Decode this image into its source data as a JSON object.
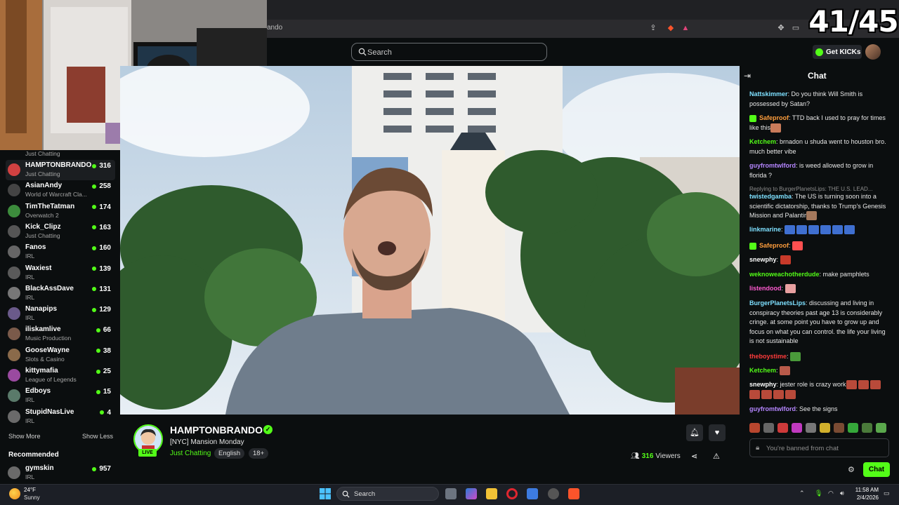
{
  "browser": {
    "address_fragment": "ando"
  },
  "counter": "41/45",
  "search": {
    "placeholder": "Search"
  },
  "header": {
    "get_kicks": "Get KICKs"
  },
  "sidebar": {
    "top_partial_category": "Just Chatting",
    "channels": [
      {
        "name": "HAMPTONBRANDO",
        "category": "Just Chatting",
        "viewers": "316"
      },
      {
        "name": "AsianAndy",
        "category": "World of Warcraft Cla...",
        "viewers": "258"
      },
      {
        "name": "TimTheTatman",
        "category": "Overwatch 2",
        "viewers": "174"
      },
      {
        "name": "Kick_Clipz",
        "category": "Just Chatting",
        "viewers": "163"
      },
      {
        "name": "Fanos",
        "category": "IRL",
        "viewers": "160"
      },
      {
        "name": "Waxiest",
        "category": "IRL",
        "viewers": "139"
      },
      {
        "name": "BlackAssDave",
        "category": "IRL",
        "viewers": "131"
      },
      {
        "name": "Nanapips",
        "category": "IRL",
        "viewers": "129"
      },
      {
        "name": "iliskamlive",
        "category": "Music Production",
        "viewers": "66"
      },
      {
        "name": "GooseWayne",
        "category": "Slots & Casino",
        "viewers": "38"
      },
      {
        "name": "kittymafia",
        "category": "League of Legends",
        "viewers": "25"
      },
      {
        "name": "Edboys",
        "category": "IRL",
        "viewers": "15"
      },
      {
        "name": "StupidNasLive",
        "category": "IRL",
        "viewers": "4"
      }
    ],
    "show_more": "Show More",
    "show_less": "Show Less",
    "recommended_heading": "Recommended",
    "recommended": [
      {
        "name": "gymskin",
        "category": "IRL",
        "viewers": "957"
      }
    ]
  },
  "stream": {
    "streamer": "HAMPTONBRANDO",
    "live_badge": "LIVE",
    "title": "[NYC] Mansion Monday",
    "category": "Just Chatting",
    "tags": [
      "English",
      "18+"
    ],
    "viewers_count": "316",
    "viewers_label": "Viewers"
  },
  "chat": {
    "title": "Chat",
    "messages": [
      {
        "user": "Nattskimmer",
        "color": "#7ee0ff",
        "text": "Do you think Will Smith is possessed by Satan?"
      },
      {
        "user": "Safeproof",
        "color": "#ff9e3d",
        "text": "TTD back I used to pray for times like this"
      },
      {
        "user": "Ketchem",
        "color": "#53fc18",
        "text": "brnadon u shuda went to houston bro. much better vibe"
      },
      {
        "user": "guyfromtwlford",
        "color": "#b586ff",
        "text": "is weed allowed to grow in florida ?"
      },
      {
        "user": "twistedgamba",
        "color": "#7ee0ff",
        "text": "The US is turning soon into a scientific dictatorship, thanks to Trump's Genesis Mission and Palantir"
      },
      {
        "user": "linkmarine",
        "color": "#7ee0ff",
        "text": ""
      },
      {
        "user": "Safeproof",
        "color": "#ff9e3d",
        "text": ""
      },
      {
        "user": "snewphy",
        "color": "#ffffff",
        "text": ""
      },
      {
        "user": "weknoweachotherdude",
        "color": "#53fc18",
        "text": "make pamphlets"
      },
      {
        "user": "listendood",
        "color": "#ff5bd1",
        "text": ""
      },
      {
        "user": "BurgerPlanetsLips",
        "color": "#7ee0ff",
        "text": "discussing and living in conspiracy theories past age 13 is considerably cringe. at some point you have to grow up and focus on what you can control. the life your living is not sustainable"
      },
      {
        "user": "theboystime",
        "color": "#ff3b3b",
        "text": ""
      },
      {
        "user": "Ketchem",
        "color": "#53fc18",
        "text": ""
      },
      {
        "user": "snewphy",
        "color": "#ffffff",
        "text": "jester role is crazy work"
      },
      {
        "user": "guyfromtwlford",
        "color": "#b586ff",
        "text": "See the signs"
      }
    ],
    "reply_note": "Replying to BurgerPlanetsLips: THE U.S. LEAD...",
    "input_placeholder": "You're banned from chat",
    "send_label": "Chat"
  },
  "taskbar": {
    "weather_temp": "24°F",
    "weather_cond": "Sunny",
    "search_label": "Search",
    "time": "11:58 AM",
    "date": "2/4/2026"
  }
}
